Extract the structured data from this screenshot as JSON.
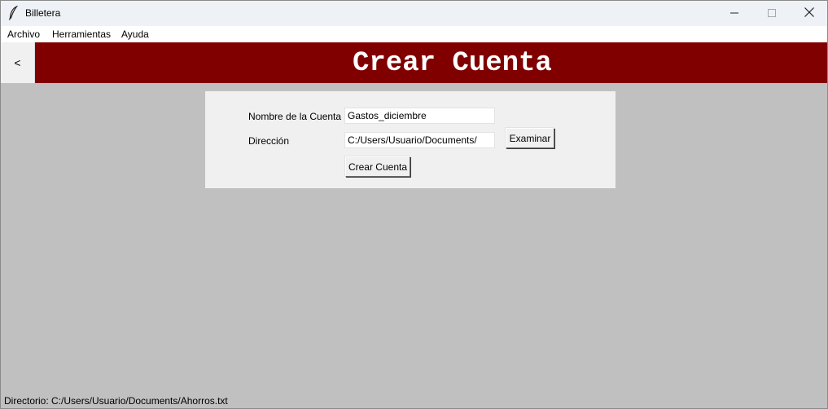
{
  "window": {
    "title": "Billetera",
    "app_icon": "feather-icon",
    "controls": {
      "minimize": "minimize-icon",
      "maximize": "maximize-icon",
      "close": "close-icon"
    }
  },
  "menubar": {
    "items": [
      {
        "label": "Archivo"
      },
      {
        "label": "Herramientas"
      },
      {
        "label": "Ayuda"
      }
    ]
  },
  "header": {
    "back_label": "<",
    "title": "Crear Cuenta",
    "background": "#800000",
    "text_color": "#ffffff"
  },
  "form": {
    "name_label": "Nombre de la Cuenta",
    "name_value": "Gastos_diciembre",
    "dir_label": "Dirección",
    "dir_value": "C:/Users/Usuario/Documents/",
    "browse_label": "Examinar",
    "submit_label": "Crear Cuenta"
  },
  "status": {
    "text": "Directorio: C:/Users/Usuario/Documents/Ahorros.txt"
  },
  "colors": {
    "body_background": "#c0c0c0",
    "panel_background": "#f0f0f0"
  }
}
